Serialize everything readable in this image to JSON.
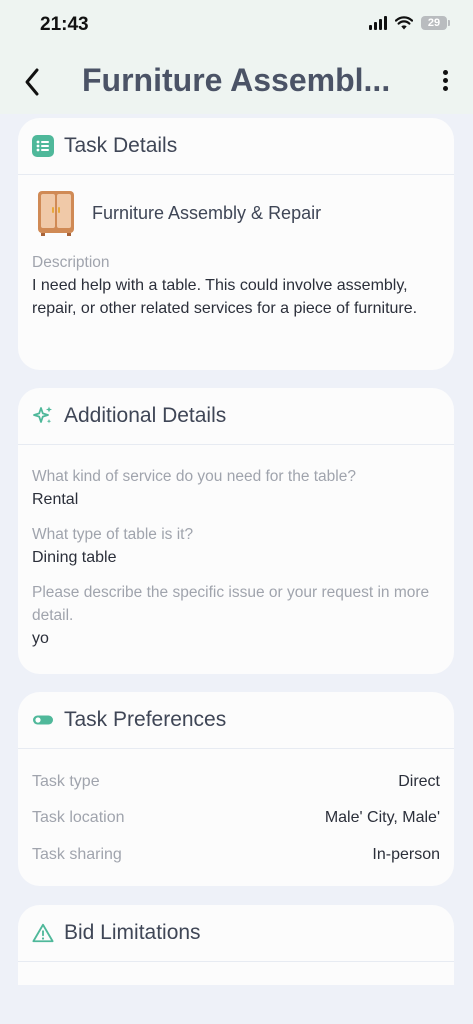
{
  "status_bar": {
    "time": "21:43",
    "battery": "29"
  },
  "header": {
    "title": "Furniture Assembl..."
  },
  "task_details": {
    "title": "Task Details",
    "service_name": "Furniture Assembly & Repair",
    "description_label": "Description",
    "description": "I need help with a table. This could involve assembly, repair, or other related services for a piece of furniture."
  },
  "additional_details": {
    "title": "Additional Details",
    "items": [
      {
        "question": "What kind of service do you need for the table?",
        "answer": "Rental"
      },
      {
        "question": "What type of table is it?",
        "answer": "Dining table"
      },
      {
        "question": "Please describe the specific issue or your request in more detail.",
        "answer": "yo"
      }
    ]
  },
  "task_preferences": {
    "title": "Task Preferences",
    "rows": [
      {
        "label": "Task type",
        "value": "Direct"
      },
      {
        "label": "Task location",
        "value": "Male' City, Male'"
      },
      {
        "label": "Task sharing",
        "value": "In-person"
      }
    ]
  },
  "bid_limitations": {
    "title": "Bid Limitations"
  },
  "colors": {
    "accent": "#4fb89a",
    "title": "#4b5366",
    "muted": "#a0a4ad"
  }
}
